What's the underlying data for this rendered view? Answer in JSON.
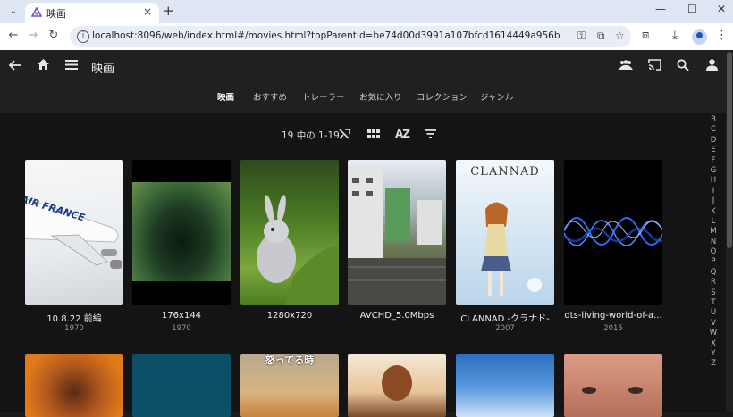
{
  "browser": {
    "tab_title": "映画",
    "tab_close": "×",
    "new_tab": "+",
    "url": "localhost:8096/web/index.html#/movies.html?topParentId=be74d00d3991a107bfcd1614449a956b",
    "window_controls": {
      "minimize": "—",
      "maximize": "☐",
      "close": "✕"
    }
  },
  "header": {
    "title": "映画",
    "icons": [
      "back-arrow-icon",
      "home-icon",
      "menu-icon",
      "people-icon",
      "cast-icon",
      "search-icon",
      "user-icon"
    ]
  },
  "nav_tabs": [
    {
      "label": "映画",
      "active": true
    },
    {
      "label": "おすすめ",
      "active": false
    },
    {
      "label": "トレーラー",
      "active": false
    },
    {
      "label": "お気に入り",
      "active": false
    },
    {
      "label": "コレクション",
      "active": false
    },
    {
      "label": "ジャンル",
      "active": false
    }
  ],
  "controls": {
    "count_text": "19 中の 1-19",
    "az_label": "AZ"
  },
  "alphabet": [
    "B",
    "C",
    "D",
    "E",
    "F",
    "G",
    "H",
    "I",
    "J",
    "K",
    "L",
    "M",
    "N",
    "O",
    "P",
    "Q",
    "R",
    "S",
    "T",
    "U",
    "V",
    "W",
    "X",
    "Y",
    "Z"
  ],
  "movies": [
    {
      "title": "10.8.22 前編",
      "year": "1970",
      "poster_text": "AIR FRANCE"
    },
    {
      "title": "176x144",
      "year": "1970"
    },
    {
      "title": "1280x720",
      "year": ""
    },
    {
      "title": "AVCHD_5.0Mbps",
      "year": ""
    },
    {
      "title": "CLANNAD -クラナド-",
      "year": "2007",
      "poster_text": "CLANNAD"
    },
    {
      "title": "dts-living-world-of-a...",
      "year": "2015"
    }
  ],
  "row2_posters": [
    {
      "poster_text": ""
    },
    {
      "poster_text": ""
    },
    {
      "poster_text": "怒ってる時"
    },
    {
      "poster_text": ""
    },
    {
      "poster_text": ""
    },
    {
      "poster_text": ""
    }
  ]
}
